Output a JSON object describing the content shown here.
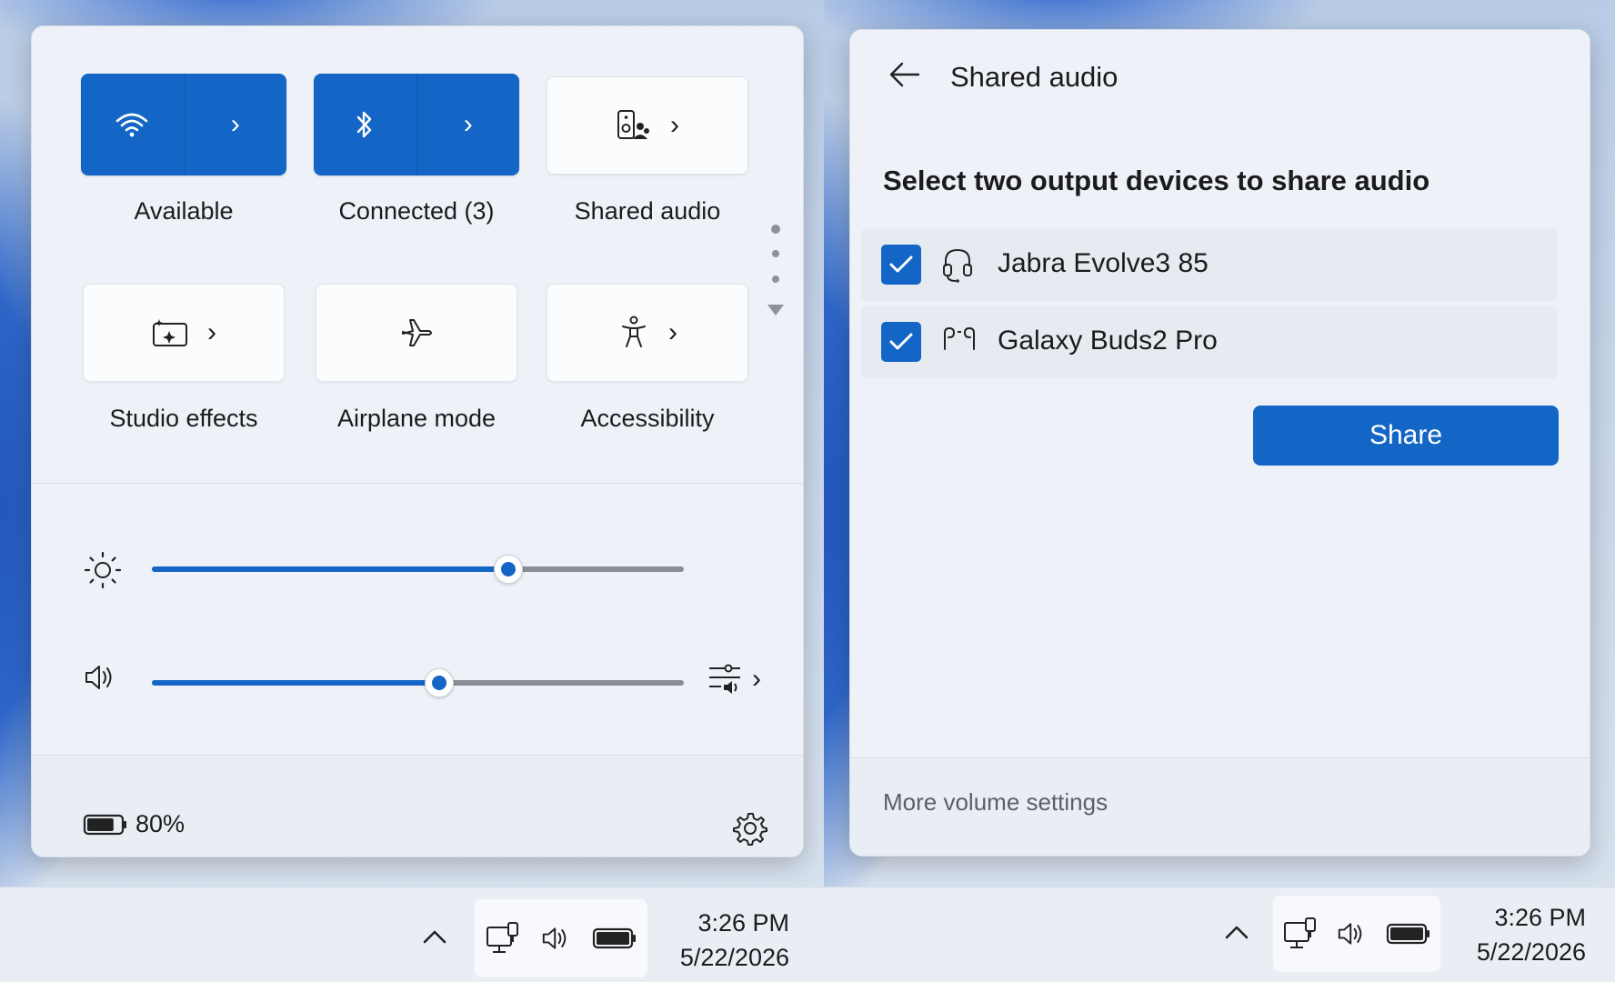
{
  "quick_settings": {
    "tiles": [
      {
        "label": "Available",
        "icon": "wifi-icon",
        "style": "split-active"
      },
      {
        "label": "Connected (3)",
        "icon": "bluetooth-icon",
        "style": "split-active"
      },
      {
        "label": "Shared audio",
        "icon": "shared-audio-icon",
        "style": "plain-chevron"
      },
      {
        "label": "Studio effects",
        "icon": "studio-effects-icon",
        "style": "plain-chevron"
      },
      {
        "label": "Airplane mode",
        "icon": "airplane-icon",
        "style": "plain"
      },
      {
        "label": "Accessibility",
        "icon": "accessibility-icon",
        "style": "plain-chevron"
      }
    ],
    "brightness": {
      "icon": "brightness-icon",
      "level_percent": 67
    },
    "volume": {
      "icon": "speaker-icon",
      "level_percent": 54,
      "mixer_icon": "volume-mixer-icon"
    },
    "battery": {
      "label": "80%",
      "level_percent": 80
    },
    "settings_icon": "gear-icon"
  },
  "shared_audio": {
    "title": "Shared audio",
    "heading": "Select two output devices to share audio",
    "devices": [
      {
        "name": "Jabra Evolve3 85",
        "icon": "headset-icon",
        "checked": true
      },
      {
        "name": "Galaxy Buds2 Pro",
        "icon": "earbuds-icon",
        "checked": true
      }
    ],
    "share_label": "Share",
    "footer_link": "More volume settings"
  },
  "taskbar": {
    "left": {
      "time": "3:26 PM",
      "date": "5/22/2026"
    },
    "right": {
      "time": "3:26 PM",
      "date": "5/22/2026"
    }
  },
  "colors": {
    "accent": "#1466c6",
    "panel": "#eef2f8",
    "track": "#8a8d92"
  }
}
